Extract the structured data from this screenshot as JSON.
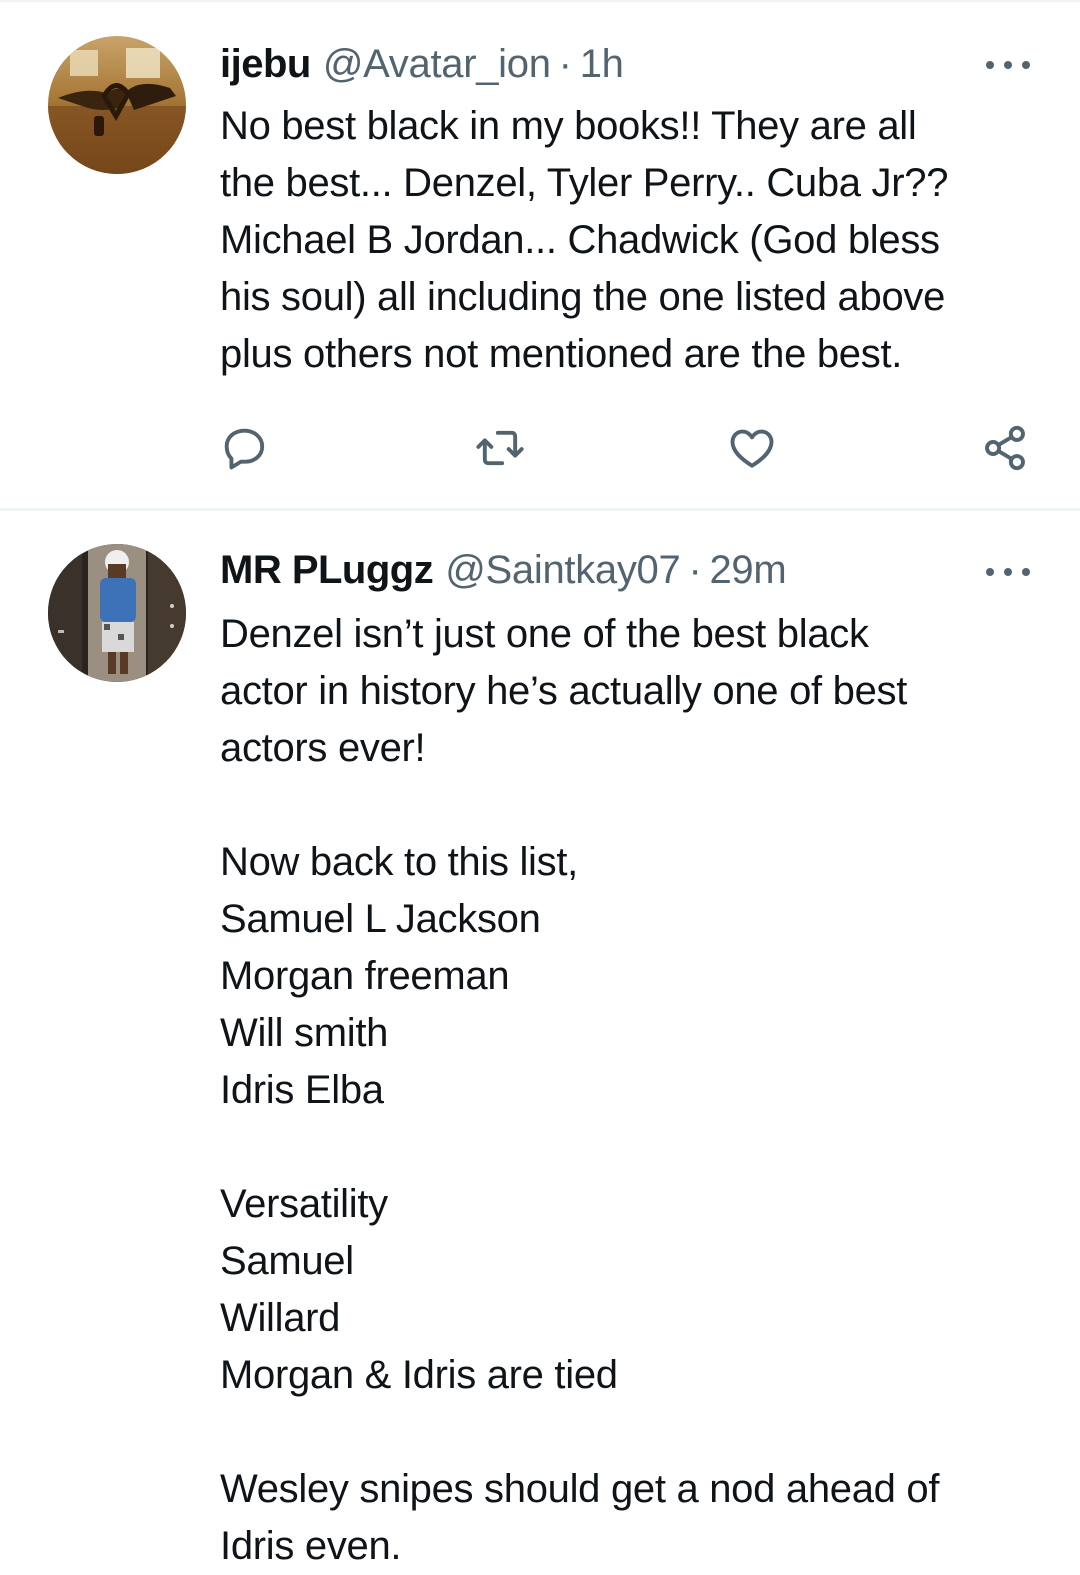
{
  "tweets": [
    {
      "display_name": "ijebu",
      "handle": "@Avatar_ion",
      "separator": "·",
      "time": "1h",
      "text": "No best black in my books!! They are all\nthe best... Denzel, Tyler Perry.. Cuba Jr??\nMichael B Jordan... Chadwick (God bless\nhis soul) all including the one listed above\nplus others not mentioned are the best.",
      "actions": [
        "reply-icon",
        "retweet-icon",
        "like-icon",
        "share-icon"
      ]
    },
    {
      "display_name": "MR PLuggz",
      "handle": "@Saintkay07",
      "separator": "·",
      "time": "29m",
      "text": "Denzel isn’t just one of the best black\nactor in history he’s actually one of best\nactors ever!\n\nNow back to this list,\nSamuel L Jackson\nMorgan freeman\nWill smith\nIdris Elba\n\nVersatility\nSamuel\nWillard\nMorgan & Idris are tied\n\nWesley snipes should get a nod ahead of\nIdris even."
    }
  ],
  "colors": {
    "text_primary": "#0f1419",
    "text_secondary": "#536471",
    "divider": "#eff3f4",
    "background": "#ffffff"
  }
}
